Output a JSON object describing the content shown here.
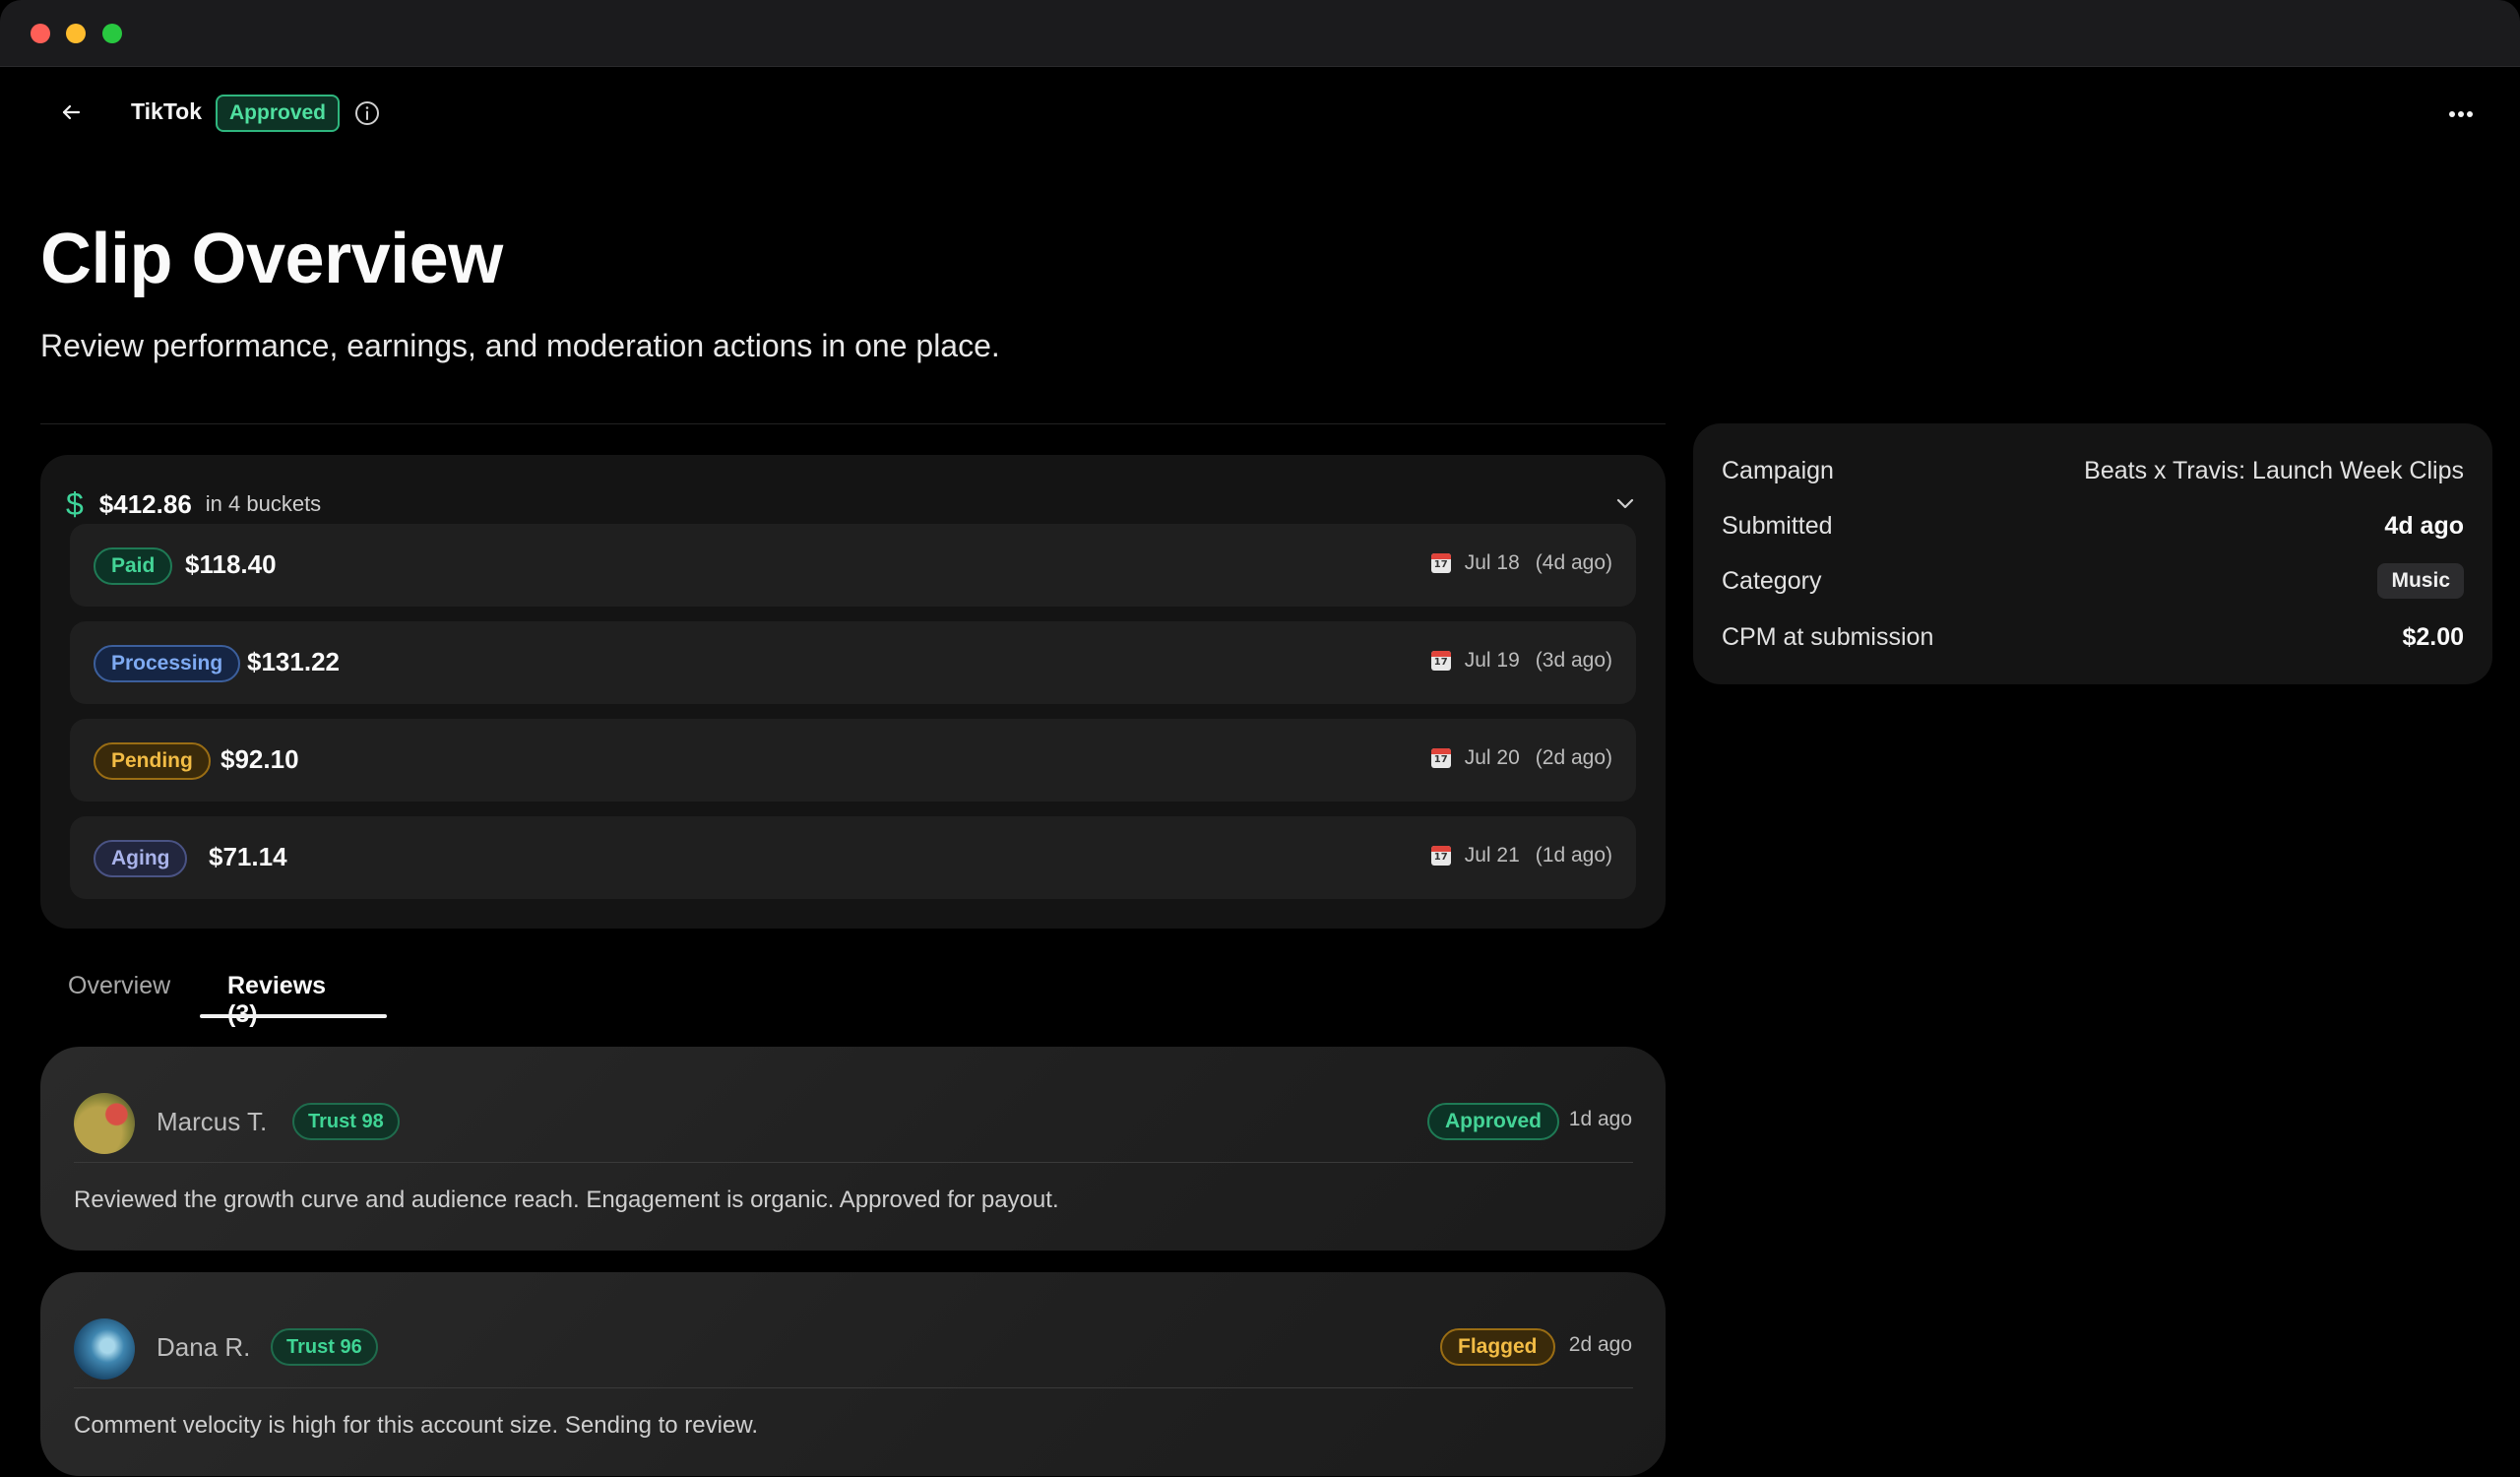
{
  "header": {
    "app_name": "TikTok",
    "status": "Approved"
  },
  "page": {
    "title": "Clip Overview",
    "subtitle": "Review performance, earnings, and moderation actions in one place."
  },
  "earnings": {
    "total": "$412.86",
    "buckets_label": "in 4 buckets",
    "buckets": [
      {
        "status": "Paid",
        "amount": "$118.40",
        "date": "Jul 18",
        "relative": "(4d ago)"
      },
      {
        "status": "Processing",
        "amount": "$131.22",
        "date": "Jul 19",
        "relative": "(3d ago)"
      },
      {
        "status": "Pending",
        "amount": "$92.10",
        "date": "Jul 20",
        "relative": "(2d ago)"
      },
      {
        "status": "Aging",
        "amount": "$71.14",
        "date": "Jul 21",
        "relative": "(1d ago)"
      }
    ]
  },
  "details": {
    "campaign_label": "Campaign",
    "campaign_value": "Beats x Travis: Launch Week Clips",
    "submitted_label": "Submitted",
    "submitted_value": "4d ago",
    "category_label": "Category",
    "category_value": "Music",
    "cpm_label": "CPM at submission",
    "cpm_value": "$2.00"
  },
  "tabs": [
    {
      "label": "Overview",
      "active": false
    },
    {
      "label": "Reviews (3)",
      "active": true
    }
  ],
  "reviews": [
    {
      "name": "Marcus T.",
      "trust": "Trust 98",
      "status": "Approved",
      "ago": "1d ago",
      "comment": "Reviewed the growth curve and audience reach. Engagement is organic. Approved for payout."
    },
    {
      "name": "Dana R.",
      "trust": "Trust 96",
      "status": "Flagged",
      "ago": "2d ago",
      "comment": "Comment velocity is high for this account size. Sending to review."
    }
  ],
  "colors": {
    "accent_green": "#44d497",
    "processing_blue": "#7eaaf2",
    "pending_amber": "#f2bc45",
    "aging_lavender": "#a9b3ea",
    "background": "#000000",
    "card": "#141414"
  },
  "icons": {
    "back": "arrow-left-icon",
    "info": "info-icon",
    "more": "more-horizontal-icon",
    "dollar": "dollar-icon",
    "chevron": "chevron-down-icon",
    "calendar": "calendar-icon"
  }
}
